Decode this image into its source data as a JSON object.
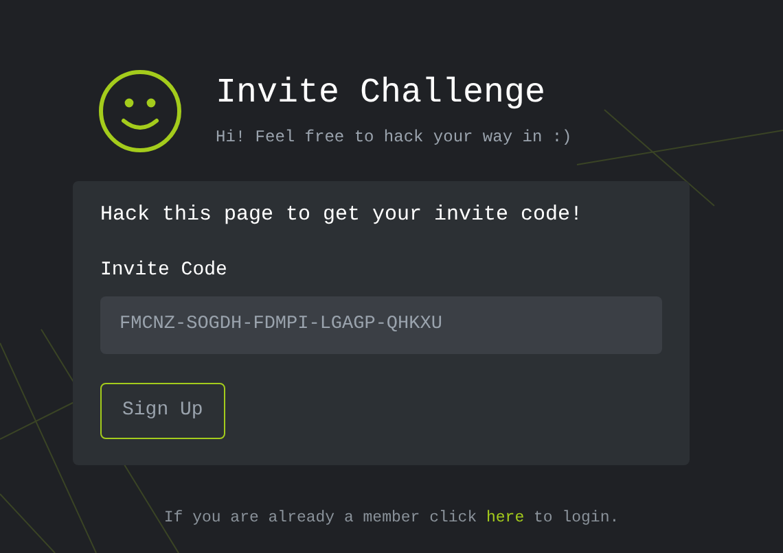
{
  "header": {
    "title": "Invite Challenge",
    "subtitle": "Hi! Feel free to hack your way in :)"
  },
  "card": {
    "heading": "Hack this page to get your invite code!",
    "field_label": "Invite Code",
    "field_value": "FMCNZ-SOGDH-FDMPI-LGAGP-QHKXU",
    "button": "Sign Up"
  },
  "footer": {
    "before": "If you are already a member click",
    "link": "here",
    "after": "to login."
  }
}
